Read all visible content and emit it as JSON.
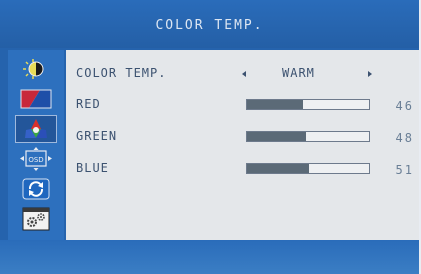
{
  "menu": {
    "title": "COLOR TEMP."
  },
  "sidebar": {
    "items": [
      {
        "icon": "brightness-icon"
      },
      {
        "icon": "image-settings-icon"
      },
      {
        "icon": "color-icon",
        "selected": true
      },
      {
        "icon": "osd-icon",
        "text": "OSD"
      },
      {
        "icon": "reset-icon"
      },
      {
        "icon": "setup-icon"
      }
    ]
  },
  "panel": {
    "mode": {
      "label": "COLOR TEMP.",
      "value": "WARM"
    },
    "channels": [
      {
        "label": "RED",
        "value": "46",
        "level": 0.46
      },
      {
        "label": "GREEN",
        "value": "48",
        "level": 0.48
      },
      {
        "label": "BLUE",
        "value": "51",
        "level": 0.51
      }
    ]
  },
  "colors": {
    "frame": "#2563ad",
    "panel": "#e4e7ea",
    "text": "#3c5270",
    "bar_fill": "#5b6a77"
  }
}
